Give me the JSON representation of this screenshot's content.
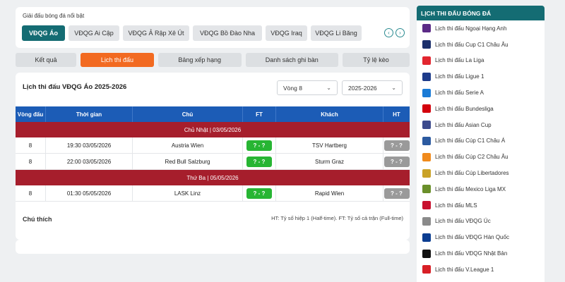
{
  "leagues": {
    "title": "Giải đấu bóng đá nổi bật",
    "items": [
      {
        "label": "VĐQG Áo",
        "active": true,
        "width": 61
      },
      {
        "label": "VĐQG Ai Cập",
        "active": false,
        "width": 72
      },
      {
        "label": "VĐQG Ả Rập Xê Út",
        "active": false,
        "width": 94
      },
      {
        "label": "VĐQG Bồ Đào Nha",
        "active": false,
        "width": 98
      },
      {
        "label": "VĐQG Iraq",
        "active": false,
        "width": 59
      },
      {
        "label": "VĐQG Li Băng",
        "active": false,
        "width": 72
      }
    ]
  },
  "tabs": [
    {
      "label": "Kết quả",
      "active": false
    },
    {
      "label": "Lịch thi đấu",
      "active": true
    },
    {
      "label": "Bảng xếp hạng",
      "active": false
    },
    {
      "label": "Danh sách ghi bàn",
      "active": false
    },
    {
      "label": "Tỷ lệ kèo",
      "active": false
    }
  ],
  "schedule": {
    "title": "Lịch thi đấu VĐQG Áo 2025-2026",
    "round_select": "Vòng 8",
    "season_select": "2025-2026",
    "headers": {
      "round": "Vòng đấu",
      "time": "Thời gian",
      "home": "Chủ",
      "ft": "FT",
      "away": "Khách",
      "ht": "HT"
    },
    "groups": [
      {
        "date": "Chủ Nhật | 03/05/2026",
        "matches": [
          {
            "round": "8",
            "time": "19:30 03/05/2026",
            "home": "Austria Wien",
            "ft": "? - ?",
            "away": "TSV Hartberg",
            "ht": "? - ?"
          },
          {
            "round": "8",
            "time": "22:00 03/05/2026",
            "home": "Red Bull Salzburg",
            "ft": "? - ?",
            "away": "Sturm Graz",
            "ht": "? - ?"
          }
        ]
      },
      {
        "date": "Thứ Ba | 05/05/2026",
        "matches": [
          {
            "round": "8",
            "time": "01:30 05/05/2026",
            "home": "LASK Linz",
            "ft": "? - ?",
            "away": "Rapid Wien",
            "ht": "? - ?"
          }
        ]
      }
    ]
  },
  "note": {
    "label": "Chú thích",
    "text": "HT: Tỷ số hiệp 1 (Half-time). FT: Tỷ số cả trận (Full-time)"
  },
  "sidebar": {
    "title": "LỊCH THI ĐẤU BÓNG ĐÁ",
    "items": [
      {
        "label": "Lịch thi đấu Ngoại Hạng Anh",
        "icon": "premier-league-logo",
        "color": "#5b2a86"
      },
      {
        "label": "Lịch thi đấu Cup C1 Châu Âu",
        "icon": "champions-league-logo",
        "color": "#1b2f6b"
      },
      {
        "label": "Lịch thi đấu La Liga",
        "icon": "laliga-logo",
        "color": "#e2262f"
      },
      {
        "label": "Lịch thi đấu Ligue 1",
        "icon": "ligue1-logo",
        "color": "#1d3b8a"
      },
      {
        "label": "Lịch thi đấu Serie A",
        "icon": "serie-a-logo",
        "color": "#1a7bd6"
      },
      {
        "label": "Lịch thi đấu Bundesliga",
        "icon": "bundesliga-logo",
        "color": "#d3010c"
      },
      {
        "label": "Lịch thi đấu Asian Cup",
        "icon": "asian-cup-logo",
        "color": "#3c4a8c"
      },
      {
        "label": "Lịch thi đấu Cúp C1 Châu Á",
        "icon": "afc-champions-logo",
        "color": "#2c5aa0"
      },
      {
        "label": "Lịch thi đấu Cúp C2 Châu Âu",
        "icon": "europa-league-logo",
        "color": "#f08a1c"
      },
      {
        "label": "Lịch thi đấu Cúp Libertadores",
        "icon": "libertadores-logo",
        "color": "#c9a227"
      },
      {
        "label": "Lịch thi đấu Mexico Liga MX",
        "icon": "liga-mx-logo",
        "color": "#6a8f2a"
      },
      {
        "label": "Lịch thi đấu MLS",
        "icon": "mls-logo",
        "color": "#c8102e"
      },
      {
        "label": "Lịch thi đấu VĐQG Úc",
        "icon": "a-league-logo",
        "color": "#8a8a8a"
      },
      {
        "label": "Lịch thi đấu VĐQG Hàn Quốc",
        "icon": "k-league-logo",
        "color": "#0b3d91"
      },
      {
        "label": "Lịch thi đấu VĐQG Nhật Bản",
        "icon": "j-league-logo",
        "color": "#111111"
      },
      {
        "label": "Lịch thi đấu V.League 1",
        "icon": "v-league-logo",
        "color": "#d81f26"
      }
    ]
  }
}
